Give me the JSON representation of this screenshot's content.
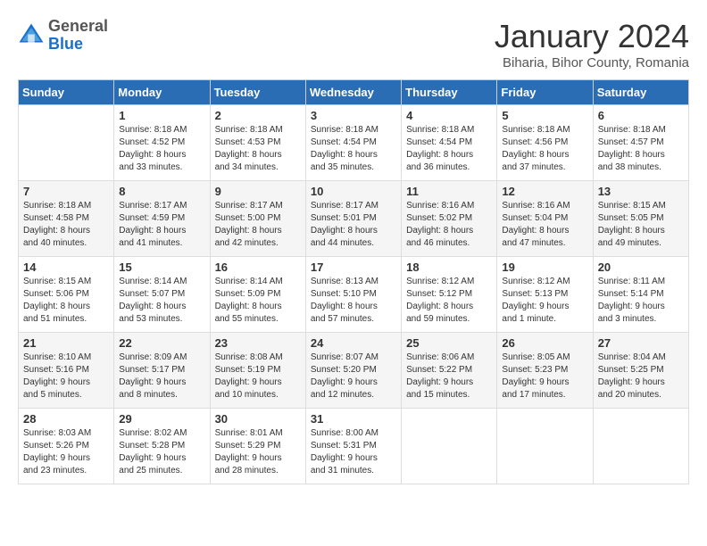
{
  "header": {
    "logo_line1": "General",
    "logo_line2": "Blue",
    "month": "January 2024",
    "location": "Biharia, Bihor County, Romania"
  },
  "weekdays": [
    "Sunday",
    "Monday",
    "Tuesday",
    "Wednesday",
    "Thursday",
    "Friday",
    "Saturday"
  ],
  "weeks": [
    [
      {
        "day": "",
        "info": ""
      },
      {
        "day": "1",
        "info": "Sunrise: 8:18 AM\nSunset: 4:52 PM\nDaylight: 8 hours\nand 33 minutes."
      },
      {
        "day": "2",
        "info": "Sunrise: 8:18 AM\nSunset: 4:53 PM\nDaylight: 8 hours\nand 34 minutes."
      },
      {
        "day": "3",
        "info": "Sunrise: 8:18 AM\nSunset: 4:54 PM\nDaylight: 8 hours\nand 35 minutes."
      },
      {
        "day": "4",
        "info": "Sunrise: 8:18 AM\nSunset: 4:54 PM\nDaylight: 8 hours\nand 36 minutes."
      },
      {
        "day": "5",
        "info": "Sunrise: 8:18 AM\nSunset: 4:56 PM\nDaylight: 8 hours\nand 37 minutes."
      },
      {
        "day": "6",
        "info": "Sunrise: 8:18 AM\nSunset: 4:57 PM\nDaylight: 8 hours\nand 38 minutes."
      }
    ],
    [
      {
        "day": "7",
        "info": "Sunrise: 8:18 AM\nSunset: 4:58 PM\nDaylight: 8 hours\nand 40 minutes."
      },
      {
        "day": "8",
        "info": "Sunrise: 8:17 AM\nSunset: 4:59 PM\nDaylight: 8 hours\nand 41 minutes."
      },
      {
        "day": "9",
        "info": "Sunrise: 8:17 AM\nSunset: 5:00 PM\nDaylight: 8 hours\nand 42 minutes."
      },
      {
        "day": "10",
        "info": "Sunrise: 8:17 AM\nSunset: 5:01 PM\nDaylight: 8 hours\nand 44 minutes."
      },
      {
        "day": "11",
        "info": "Sunrise: 8:16 AM\nSunset: 5:02 PM\nDaylight: 8 hours\nand 46 minutes."
      },
      {
        "day": "12",
        "info": "Sunrise: 8:16 AM\nSunset: 5:04 PM\nDaylight: 8 hours\nand 47 minutes."
      },
      {
        "day": "13",
        "info": "Sunrise: 8:15 AM\nSunset: 5:05 PM\nDaylight: 8 hours\nand 49 minutes."
      }
    ],
    [
      {
        "day": "14",
        "info": "Sunrise: 8:15 AM\nSunset: 5:06 PM\nDaylight: 8 hours\nand 51 minutes."
      },
      {
        "day": "15",
        "info": "Sunrise: 8:14 AM\nSunset: 5:07 PM\nDaylight: 8 hours\nand 53 minutes."
      },
      {
        "day": "16",
        "info": "Sunrise: 8:14 AM\nSunset: 5:09 PM\nDaylight: 8 hours\nand 55 minutes."
      },
      {
        "day": "17",
        "info": "Sunrise: 8:13 AM\nSunset: 5:10 PM\nDaylight: 8 hours\nand 57 minutes."
      },
      {
        "day": "18",
        "info": "Sunrise: 8:12 AM\nSunset: 5:12 PM\nDaylight: 8 hours\nand 59 minutes."
      },
      {
        "day": "19",
        "info": "Sunrise: 8:12 AM\nSunset: 5:13 PM\nDaylight: 9 hours\nand 1 minute."
      },
      {
        "day": "20",
        "info": "Sunrise: 8:11 AM\nSunset: 5:14 PM\nDaylight: 9 hours\nand 3 minutes."
      }
    ],
    [
      {
        "day": "21",
        "info": "Sunrise: 8:10 AM\nSunset: 5:16 PM\nDaylight: 9 hours\nand 5 minutes."
      },
      {
        "day": "22",
        "info": "Sunrise: 8:09 AM\nSunset: 5:17 PM\nDaylight: 9 hours\nand 8 minutes."
      },
      {
        "day": "23",
        "info": "Sunrise: 8:08 AM\nSunset: 5:19 PM\nDaylight: 9 hours\nand 10 minutes."
      },
      {
        "day": "24",
        "info": "Sunrise: 8:07 AM\nSunset: 5:20 PM\nDaylight: 9 hours\nand 12 minutes."
      },
      {
        "day": "25",
        "info": "Sunrise: 8:06 AM\nSunset: 5:22 PM\nDaylight: 9 hours\nand 15 minutes."
      },
      {
        "day": "26",
        "info": "Sunrise: 8:05 AM\nSunset: 5:23 PM\nDaylight: 9 hours\nand 17 minutes."
      },
      {
        "day": "27",
        "info": "Sunrise: 8:04 AM\nSunset: 5:25 PM\nDaylight: 9 hours\nand 20 minutes."
      }
    ],
    [
      {
        "day": "28",
        "info": "Sunrise: 8:03 AM\nSunset: 5:26 PM\nDaylight: 9 hours\nand 23 minutes."
      },
      {
        "day": "29",
        "info": "Sunrise: 8:02 AM\nSunset: 5:28 PM\nDaylight: 9 hours\nand 25 minutes."
      },
      {
        "day": "30",
        "info": "Sunrise: 8:01 AM\nSunset: 5:29 PM\nDaylight: 9 hours\nand 28 minutes."
      },
      {
        "day": "31",
        "info": "Sunrise: 8:00 AM\nSunset: 5:31 PM\nDaylight: 9 hours\nand 31 minutes."
      },
      {
        "day": "",
        "info": ""
      },
      {
        "day": "",
        "info": ""
      },
      {
        "day": "",
        "info": ""
      }
    ]
  ]
}
